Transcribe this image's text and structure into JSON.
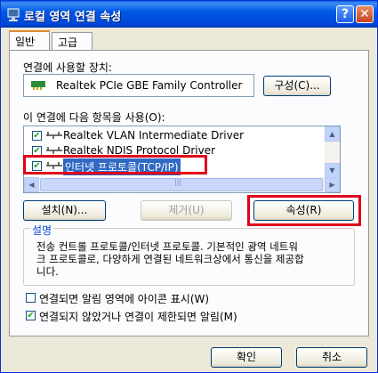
{
  "window": {
    "title": "로컬 영역 연결 속성",
    "help_label": "?",
    "close_label": "✕"
  },
  "tabs": [
    {
      "label": "일반"
    },
    {
      "label": "고급"
    }
  ],
  "device": {
    "label": "연결에 사용할 장치:",
    "name": "Realtek PCIe GBE Family Controller",
    "configure_button": "구성(C)..."
  },
  "components": {
    "label": "이 연결에 다음 항목을 사용(O):",
    "items": [
      {
        "label": "Realtek VLAN Intermediate Driver",
        "checked": true
      },
      {
        "label": "Realtek NDIS Protocol Driver",
        "checked": true
      },
      {
        "label": "인터넷 프로토콜(TCP/IP)",
        "checked": true
      }
    ],
    "scroll_up": "▲",
    "scroll_down": "▼",
    "scroll_left": "◀",
    "scroll_right": "▶",
    "thumb_grip": "|||"
  },
  "actions": {
    "install": "설치(N)...",
    "uninstall": "제거(U)",
    "properties": "속성(R)"
  },
  "description": {
    "heading": "설명",
    "text1": "전송 컨트롤 프로토콜/인터넷 프로토콜. 기본적인 광역 네트워",
    "text2": "크 프로토콜로, 다양하게 연결된 네트워크상에서 통신을 제공합",
    "text3": "니다."
  },
  "options": [
    {
      "label": "연결되면 알림 영역에 아이콘 표시(W)",
      "checked": false
    },
    {
      "label": "연결되지 않았거나 연결이 제한되면 알림(M)",
      "checked": true
    }
  ],
  "footer": {
    "ok": "확인",
    "cancel": "취소"
  },
  "colors": {
    "highlight": "#e0001b",
    "selection": "#316ac5",
    "titlebar": "#0058e6"
  }
}
